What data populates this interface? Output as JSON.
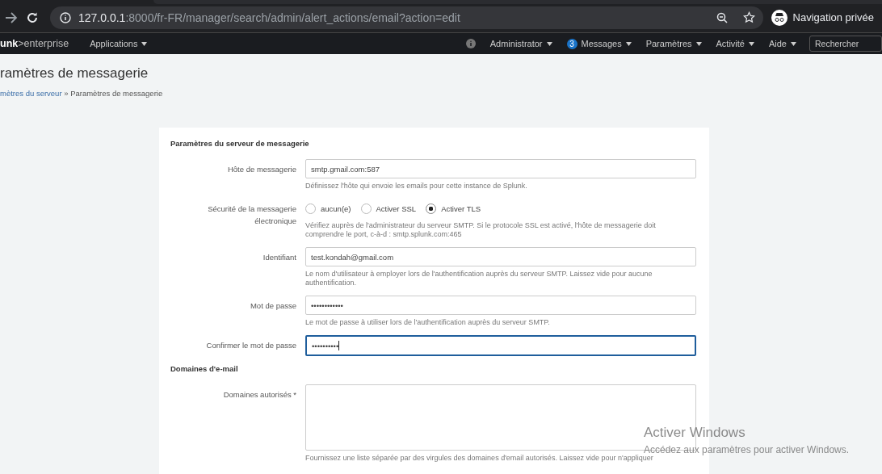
{
  "browser": {
    "url_host": "127.0.0.1",
    "url_rest": ":8000/fr-FR/manager/search/admin/alert_actions/email?action=edit",
    "profile": "Navigation privée"
  },
  "nav": {
    "logo_bold": "unk",
    "logo_rest": ">enterprise",
    "apps": "Applications",
    "items": [
      {
        "label": "Administrator"
      },
      {
        "label": "Messages",
        "badge": "3"
      },
      {
        "label": "Paramètres"
      },
      {
        "label": "Activité"
      },
      {
        "label": "Aide"
      }
    ],
    "search_placeholder": "Rechercher"
  },
  "page": {
    "title": "ramètres de messagerie",
    "breadcrumb_link": "mètres du serveur",
    "breadcrumb_sep": "»",
    "breadcrumb_current": "Paramètres de messagerie"
  },
  "sections": [
    {
      "heading": "Paramètres du serveur de messagerie",
      "fields": [
        {
          "kind": "text",
          "label": "Hôte de messagerie",
          "value": "smtp.gmail.com:587",
          "focused": false,
          "help": "Définissez l'hôte qui envoie les emails pour cette instance de Splunk."
        },
        {
          "kind": "radio",
          "label": "Sécurité de la messagerie électronique",
          "options": [
            {
              "label": "aucun(e)",
              "selected": false
            },
            {
              "label": "Activer SSL",
              "selected": false
            },
            {
              "label": "Activer TLS",
              "selected": true
            }
          ],
          "help": "Vérifiez auprès de l'administrateur du serveur SMTP. Si le protocole SSL est activé, l'hôte de messagerie doit comprendre le port, c-à-d : smtp.splunk.com:465"
        },
        {
          "kind": "text",
          "label": "Identifiant",
          "value": "test.kondah@gmail.com",
          "focused": false,
          "help": "Le nom d'utilisateur à employer lors de l'authentification auprès du serveur SMTP. Laissez vide pour aucune authentification."
        },
        {
          "kind": "text",
          "label": "Mot de passe",
          "value": "••••••••••••",
          "focused": false,
          "help": "Le mot de passe à utiliser lors de l'authentification auprès du serveur SMTP."
        },
        {
          "kind": "text",
          "label": "Confirmer le mot de passe",
          "value": "••••••••••",
          "focused": true
        }
      ]
    },
    {
      "heading": "Domaines d'e-mail",
      "fields": [
        {
          "kind": "textarea",
          "label": "Domaines autorisés *",
          "focused": false,
          "help": "Fournissez une liste séparée par des virgules des domaines d'email autorisés. Laissez vide pour n'appliquer"
        }
      ]
    }
  ],
  "activation": {
    "title": "Activer Windows",
    "text": "Accédez aux paramètres pour activer Windows."
  }
}
